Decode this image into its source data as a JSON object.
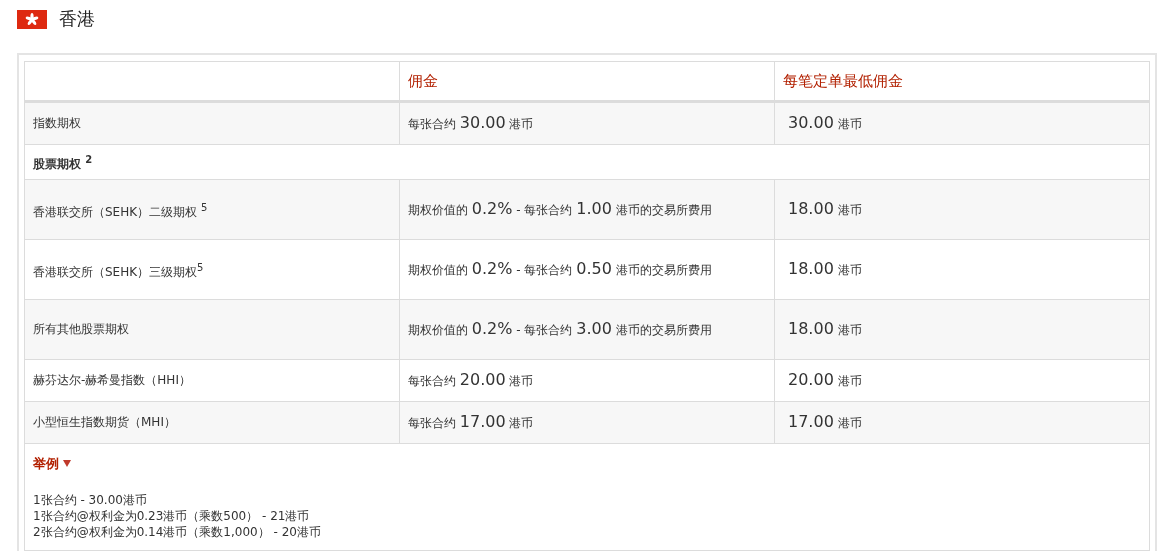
{
  "region": {
    "title": "香港"
  },
  "table": {
    "columns": [
      "佣金",
      "每笔定单最低佣金"
    ],
    "rows": [
      {
        "kind": "data",
        "label": "指数期权",
        "commission": [
          {
            "kind": "plain",
            "text": "每张合约"
          },
          {
            "kind": "amount",
            "text": "30.00"
          },
          {
            "kind": "plain",
            "text": "港币"
          }
        ],
        "minimum": [
          {
            "kind": "amount",
            "text": "30.00"
          },
          {
            "kind": "plain",
            "text": "港币"
          }
        ]
      },
      {
        "kind": "section",
        "label": "股票期权 $^{2}$"
      },
      {
        "kind": "data",
        "label": "香港联交所（SEHK）二级期权 $^{5}$",
        "commission": [
          {
            "kind": "plain",
            "text": "期权价值的"
          },
          {
            "kind": "amount",
            "text": "0.2%"
          },
          {
            "kind": "plain",
            "text": " - 每张合约"
          },
          {
            "kind": "amount",
            "text": "1.00"
          },
          {
            "kind": "plain",
            "text": "港币的交易所费用"
          }
        ],
        "minimum": [
          {
            "kind": "amount",
            "text": "18.00"
          },
          {
            "kind": "plain",
            "text": "港币"
          }
        ]
      },
      {
        "kind": "data",
        "label": "香港联交所（SEHK）三级期权$^{5}$",
        "commission": [
          {
            "kind": "plain",
            "text": "期权价值的"
          },
          {
            "kind": "amount",
            "text": "0.2%"
          },
          {
            "kind": "plain",
            "text": " - 每张合约"
          },
          {
            "kind": "amount",
            "text": "0.50"
          },
          {
            "kind": "plain",
            "text": "港币的交易所费用"
          }
        ],
        "minimum": [
          {
            "kind": "amount",
            "text": "18.00"
          },
          {
            "kind": "plain",
            "text": "港币"
          }
        ]
      },
      {
        "kind": "data",
        "label": "所有其他股票期权",
        "commission": [
          {
            "kind": "plain",
            "text": "期权价值的"
          },
          {
            "kind": "amount",
            "text": "0.2%"
          },
          {
            "kind": "plain",
            "text": " - 每张合约"
          },
          {
            "kind": "amount",
            "text": "3.00"
          },
          {
            "kind": "plain",
            "text": "港币的交易所费用"
          }
        ],
        "minimum": [
          {
            "kind": "amount",
            "text": "18.00"
          },
          {
            "kind": "plain",
            "text": "港币"
          }
        ]
      },
      {
        "kind": "data",
        "label": "赫芬达尔-赫希曼指数（HHI）",
        "commission": [
          {
            "kind": "plain",
            "text": "每张合约"
          },
          {
            "kind": "amount",
            "text": "20.00"
          },
          {
            "kind": "plain",
            "text": "港币"
          }
        ],
        "minimum": [
          {
            "kind": "amount",
            "text": "20.00"
          },
          {
            "kind": "plain",
            "text": "港币"
          }
        ]
      },
      {
        "kind": "data",
        "label": "小型恒生指数期货（MHI）",
        "commission": [
          {
            "kind": "plain",
            "text": "每张合约"
          },
          {
            "kind": "amount",
            "text": "17.00"
          },
          {
            "kind": "plain",
            "text": "港币"
          }
        ],
        "minimum": [
          {
            "kind": "amount",
            "text": "17.00"
          },
          {
            "kind": "plain",
            "text": "港币"
          }
        ]
      }
    ]
  },
  "examples": {
    "title": "举例",
    "expanded": true,
    "lines": [
      "1张合约 - 30.00港币",
      "1张合约@权利金为0.23港币（乘数500） - 21港币",
      "2张合约@权利金为0.14港币（乘数1,000） - 20港币"
    ]
  }
}
